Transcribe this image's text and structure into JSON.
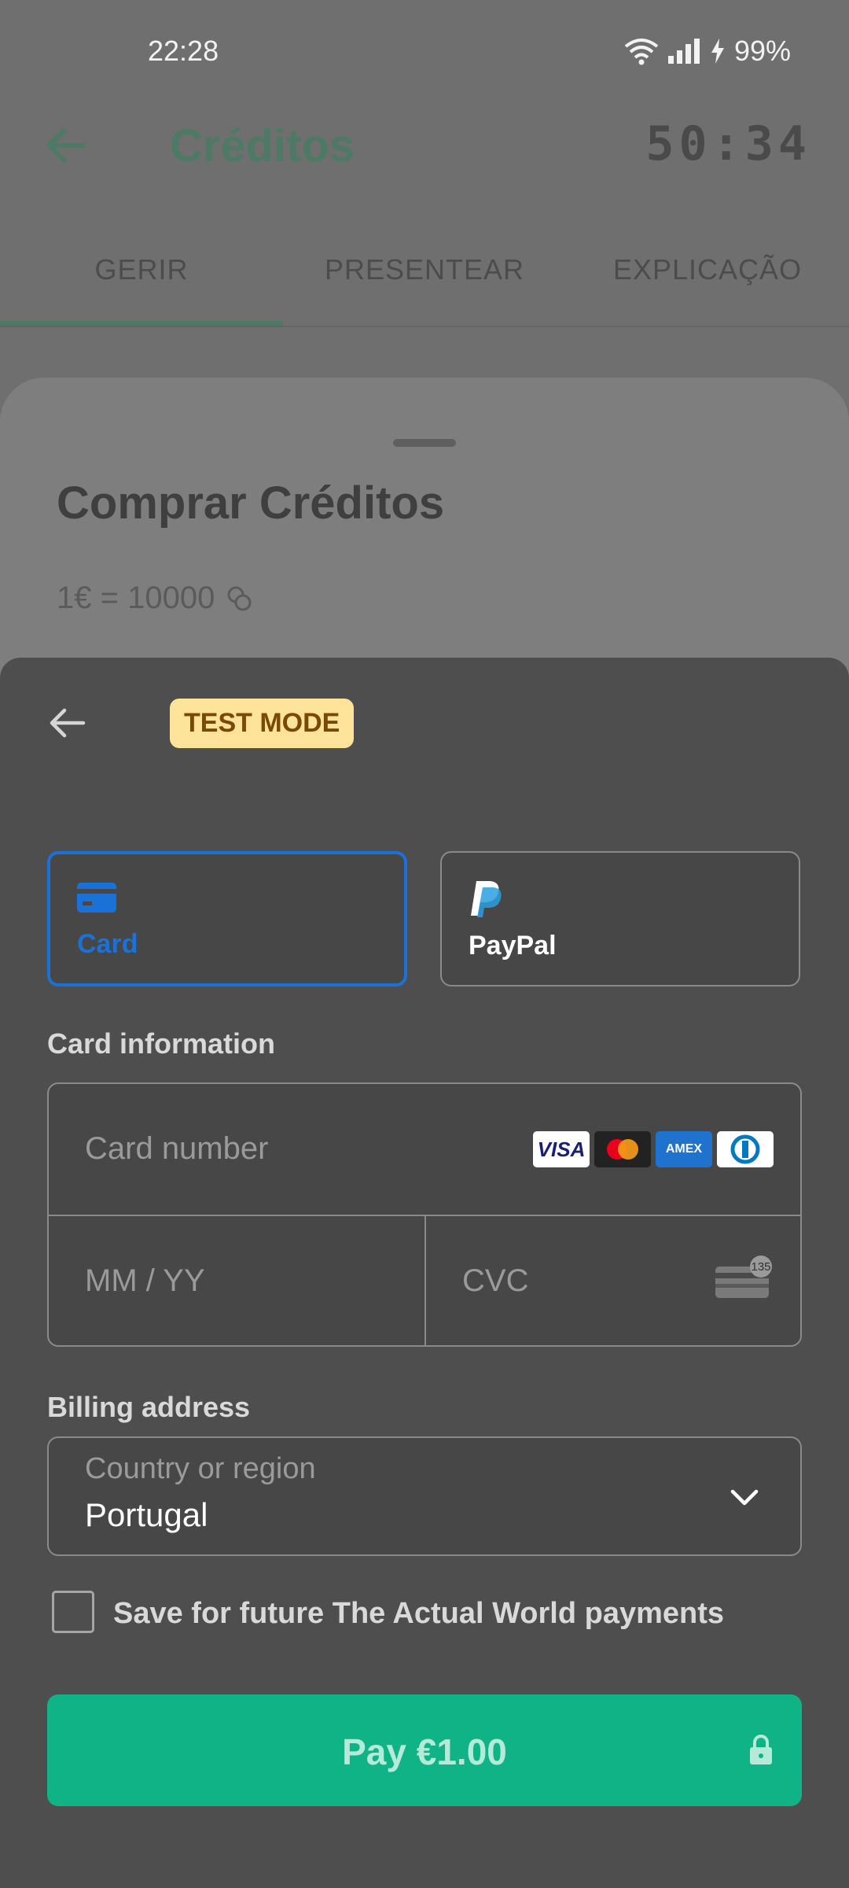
{
  "status_bar": {
    "time": "22:28",
    "battery": "99%",
    "icons": [
      "wifi-icon",
      "signal-icon",
      "charging-icon"
    ]
  },
  "app_bar": {
    "title": "Créditos",
    "timer": "50:34",
    "back_icon": "arrow-left-icon"
  },
  "tabs": [
    {
      "label": "GERIR",
      "active": true
    },
    {
      "label": "PRESENTEAR",
      "active": false
    },
    {
      "label": "EXPLICAÇÃO",
      "active": false
    }
  ],
  "buy_sheet": {
    "title": "Comprar Créditos",
    "rate": "1€ = 10000",
    "rate_icon": "coins-icon"
  },
  "payment_sheet": {
    "test_mode": "TEST MODE",
    "methods": [
      {
        "label": "Card",
        "icon": "credit-card-icon",
        "selected": true
      },
      {
        "label": "PayPal",
        "icon": "paypal-icon",
        "selected": false
      }
    ],
    "card_section_label": "Card information",
    "card_number_placeholder": "Card number",
    "expiry_placeholder": "MM / YY",
    "cvc_placeholder": "CVC",
    "cvc_hint": "135",
    "card_brands": [
      "VISA",
      "mastercard",
      "AMEX",
      "Diners Club"
    ],
    "billing_label": "Billing address",
    "country_label": "Country or region",
    "country_value": "Portugal",
    "save_label": "Save for future The Actual World payments",
    "save_checked": false,
    "pay_label": "Pay €1.00"
  },
  "colors": {
    "accent_green": "#0fb385",
    "selected_blue": "#1a72d8",
    "test_badge_bg": "#fde49a"
  }
}
